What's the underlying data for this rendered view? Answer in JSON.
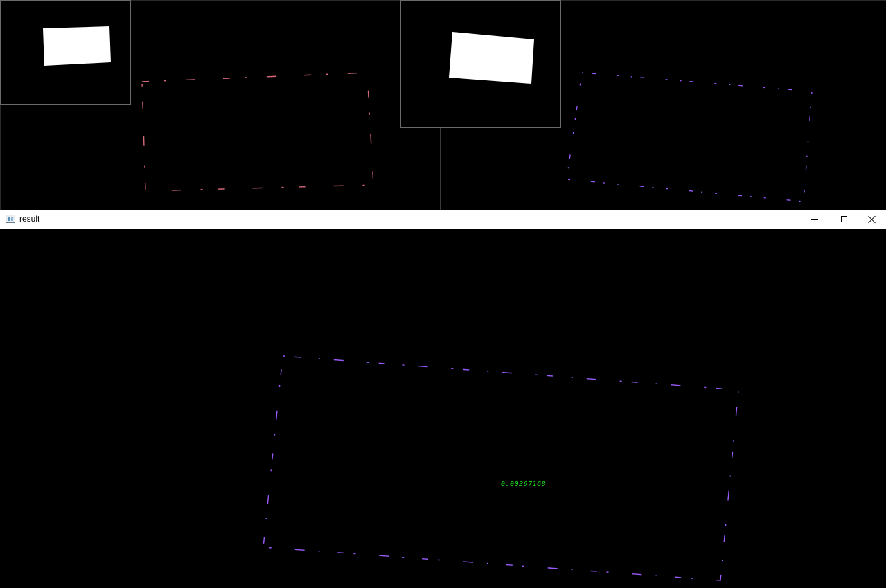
{
  "result_window": {
    "title": "result",
    "score": "0.00367168",
    "controls": {
      "minimize": "minimize-icon",
      "maximize": "maximize-icon",
      "close": "close-icon"
    }
  },
  "colors": {
    "background": "#000000",
    "mask_fill": "#ffffff",
    "contour_left": "#d96a7a",
    "contour_right": "#9a5cff",
    "contour_result": "#9a5cff",
    "score_text": "#1ee61e"
  }
}
